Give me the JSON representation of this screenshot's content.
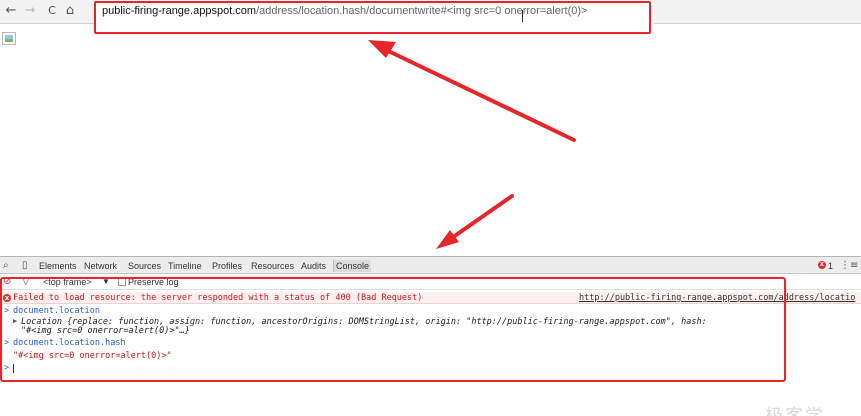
{
  "browser": {
    "back_icon": "←",
    "forward_icon": "→",
    "reload_icon": "C",
    "home_icon": "⌂",
    "url_host": "public-firing-range.appspot.com",
    "url_rest": "/address/location.hash/documentwrite#<img src=0 onerror=alert(0)>"
  },
  "devtools": {
    "tabs": [
      "Elements",
      "Network",
      "Sources",
      "Timeline",
      "Profiles",
      "Resources",
      "Audits",
      "Console"
    ],
    "active_tab": "Console",
    "error_count": "1",
    "frame_selector": "<top frame>",
    "preserve_log_label": "Preserve log"
  },
  "console": {
    "error_icon": "x",
    "error_message": "Failed to load resource: the server responded with a status of 400 (Bad Request)",
    "error_source": "http://public-firing-range.appspot.com/address/locatio",
    "cmd1": "document.location",
    "result1_line1": "Location {replace: function, assign: function, ancestorOrigins: DOMStringList, origin: \"http://public-firing-range.appspot.com\", hash:",
    "result1_line2": "\"#<img src=0 onerror=alert(0)>\"…}",
    "cmd2": "document.location.hash",
    "result2": "\"#<img src=0 onerror=alert(0)>\"",
    "prompt": ">"
  },
  "colors": {
    "annotation_red": "#e8262a",
    "error_red": "#d3181d",
    "command_blue": "#2c5ed1"
  },
  "watermark": "极客学"
}
